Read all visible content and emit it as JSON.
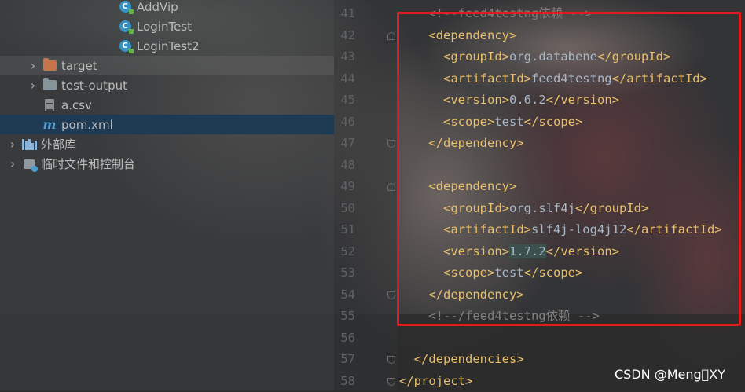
{
  "project_tree": {
    "items": [
      {
        "label": "AddVip",
        "icon": "java-class-icon",
        "indent": 3
      },
      {
        "label": "LoginTest",
        "icon": "java-class-icon",
        "indent": 3
      },
      {
        "label": "LoginTest2",
        "icon": "java-class-icon",
        "indent": 3
      },
      {
        "label": "target",
        "icon": "folder-excluded-icon",
        "expandable": true,
        "indent": 1
      },
      {
        "label": "test-output",
        "icon": "folder-icon",
        "expandable": true,
        "indent": 1
      },
      {
        "label": "a.csv",
        "icon": "csv-file-icon",
        "indent": 1
      },
      {
        "label": "pom.xml",
        "icon": "maven-icon",
        "indent": 1,
        "selected": true
      },
      {
        "label": "外部库",
        "icon": "library-icon",
        "expandable": true,
        "indent": 0
      },
      {
        "label": "临时文件和控制台",
        "icon": "scratches-icon",
        "expandable": true,
        "indent": 0
      }
    ]
  },
  "editor": {
    "lines": [
      {
        "num": "41",
        "code": "    <!--feed4testng依赖 -->",
        "kind": "comment"
      },
      {
        "num": "42",
        "code": "    <dependency>",
        "kind": "tag"
      },
      {
        "num": "43",
        "code": "      <groupId>org.databene</groupId>",
        "kind": "mixed"
      },
      {
        "num": "44",
        "code": "      <artifactId>feed4testng</artifactId>",
        "kind": "mixed"
      },
      {
        "num": "45",
        "code": "      <version>0.6.2</version>",
        "kind": "mixed"
      },
      {
        "num": "46",
        "code": "      <scope>test</scope>",
        "kind": "mixed"
      },
      {
        "num": "47",
        "code": "    </dependency>",
        "kind": "tag"
      },
      {
        "num": "48",
        "code": "",
        "kind": "blank"
      },
      {
        "num": "49",
        "code": "    <dependency>",
        "kind": "tag"
      },
      {
        "num": "50",
        "code": "      <groupId>org.slf4j</groupId>",
        "kind": "mixed"
      },
      {
        "num": "51",
        "code": "      <artifactId>slf4j-log4j12</artifactId>",
        "kind": "mixed"
      },
      {
        "num": "52",
        "code": "      <version>1.7.2</version>",
        "kind": "mixed",
        "highlight": "1.7.2"
      },
      {
        "num": "53",
        "code": "      <scope>test</scope>",
        "kind": "mixed"
      },
      {
        "num": "54",
        "code": "    </dependency>",
        "kind": "tag"
      },
      {
        "num": "55",
        "code": "    <!--/feed4testng依赖 -->",
        "kind": "comment"
      },
      {
        "num": "56",
        "code": "",
        "kind": "blank"
      },
      {
        "num": "57",
        "code": "  </dependencies>",
        "kind": "tag"
      },
      {
        "num": "58",
        "code": "</project>",
        "kind": "tag"
      }
    ]
  },
  "watermark": "CSDN @Meng\u0000XY",
  "colors": {
    "tag": "#e8bf6a",
    "text": "#a9b7c6",
    "comment": "#808080",
    "selection": "#1f3b54",
    "annotation_box": "#e21b1b"
  }
}
